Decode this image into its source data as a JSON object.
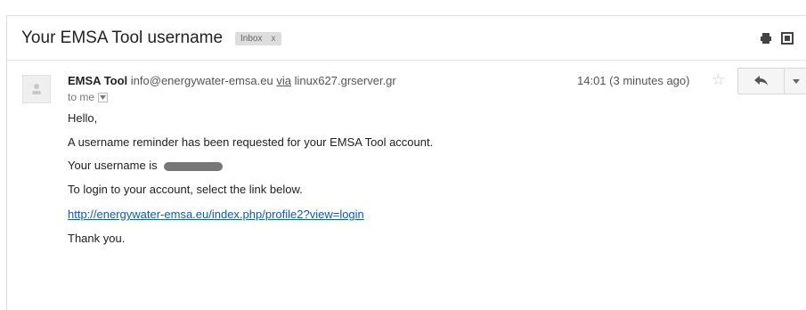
{
  "email": {
    "subject": "Your EMSA Tool username",
    "label": {
      "name": "Inbox",
      "remove": "x"
    },
    "sender": {
      "name": "EMSA Tool",
      "address": "info@energywater-emsa.eu",
      "via_label": "via",
      "via_server": "linux627.grserver.gr"
    },
    "recipient_label": "to me",
    "timestamp": "14:01 (3 minutes ago)",
    "body": {
      "greeting": "Hello,",
      "line1": "A username reminder has been requested for your EMSA Tool account.",
      "line2_prefix": "Your username is",
      "line3": "To login to your account, select the link below.",
      "link": "http://energywater-emsa.eu/index.php/profile2?view=login",
      "closing": "Thank you."
    }
  },
  "icons": {
    "print": "print-icon",
    "new_window": "new-window-icon",
    "star": "star-icon",
    "reply": "reply-icon",
    "more": "chevron-down-icon"
  },
  "colors": {
    "link": "#1155cc",
    "label_bg": "#dddddd"
  }
}
